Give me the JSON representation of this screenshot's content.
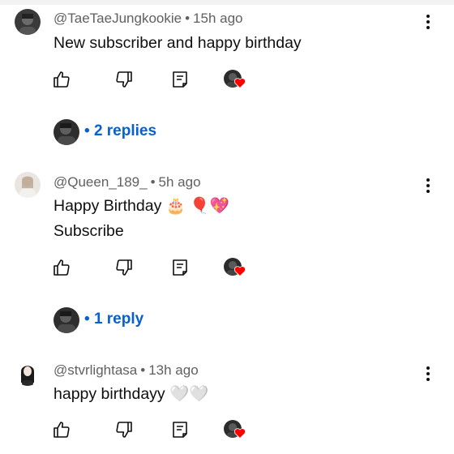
{
  "comments": [
    {
      "author": "@TaeTaeJungkookie",
      "time": "15h ago",
      "lines": [
        "New subscriber and happy birthday"
      ],
      "replies_label": "2 replies"
    },
    {
      "author": "@Queen_189_",
      "time": "5h ago",
      "lines": [
        "Happy Birthday 🎂 🎈💖",
        "Subscribe"
      ],
      "replies_label": "1 reply"
    },
    {
      "author": "@stvrlightasa",
      "time": "13h ago",
      "lines": [
        "happy birthdayy 🤍🤍"
      ]
    }
  ],
  "separator": "•",
  "icons": {
    "like": "thumbs-up-icon",
    "dislike": "thumbs-down-icon",
    "reply": "reply-comment-icon",
    "creator_heart": "creator-heart-icon",
    "more": "more-vert-icon"
  },
  "colors": {
    "link_blue": "#065fd4",
    "meta_gray": "#606060",
    "heart_red": "#ff0000",
    "text": "#0f0f0f"
  }
}
